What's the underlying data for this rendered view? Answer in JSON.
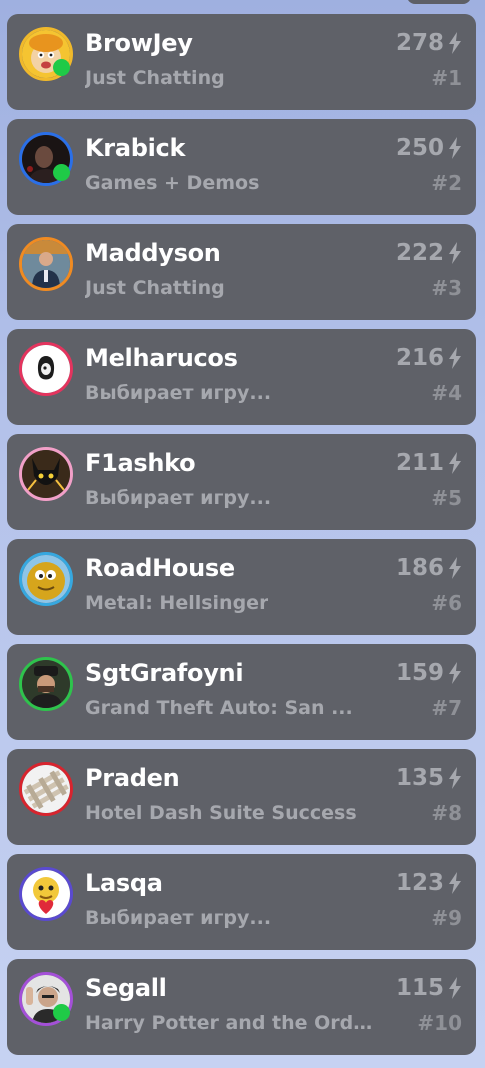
{
  "streamers": [
    {
      "name": "BrowJey",
      "category": "Just Chatting",
      "points": "278",
      "rank": "#1",
      "ring": "#f0b92b",
      "online": true,
      "avatar": "cartoon-face"
    },
    {
      "name": "Krabick",
      "category": "Games + Demos",
      "points": "250",
      "rank": "#2",
      "ring": "#2a6fe8",
      "online": true,
      "avatar": "dark-portrait"
    },
    {
      "name": "Maddyson",
      "category": "Just Chatting",
      "points": "222",
      "rank": "#3",
      "ring": "#f08b22",
      "online": false,
      "avatar": "man-suit"
    },
    {
      "name": "Melharucos",
      "category": "Выбирает игру...",
      "points": "216",
      "rank": "#4",
      "ring": "#e4345e",
      "online": false,
      "avatar": "egg-mask"
    },
    {
      "name": "F1ashko",
      "category": "Выбирает игру...",
      "points": "211",
      "rank": "#5",
      "ring": "#f2a0c8",
      "online": false,
      "avatar": "black-cat"
    },
    {
      "name": "RoadHouse",
      "category": "Metal: Hellsinger",
      "points": "186",
      "rank": "#6",
      "ring": "#36a8e0",
      "online": false,
      "avatar": "yellow-blob"
    },
    {
      "name": "SgtGrafoyni",
      "category": "Grand Theft Auto: San ...",
      "points": "159",
      "rank": "#7",
      "ring": "#2ec44c",
      "online": false,
      "avatar": "officer"
    },
    {
      "name": "Praden",
      "category": "Hotel Dash Suite Success",
      "points": "135",
      "rank": "#8",
      "ring": "#d8242e",
      "online": false,
      "avatar": "pallet"
    },
    {
      "name": "Lasqa",
      "category": "Выбирает игру...",
      "points": "123",
      "rank": "#9",
      "ring": "#5a4ad0",
      "online": false,
      "avatar": "cartoon-heart"
    },
    {
      "name": "Segall",
      "category": "Harry Potter and the Orde...",
      "points": "115",
      "rank": "#10",
      "ring": "#a450d8",
      "online": true,
      "avatar": "man-waving"
    }
  ],
  "colors": {
    "card": "#5f6168",
    "name": "#ffffff",
    "sub": "#a6a8ae",
    "online": "#1fca47"
  },
  "icons": {
    "points": "lightning-bolt-icon",
    "online": "online-dot-icon"
  }
}
